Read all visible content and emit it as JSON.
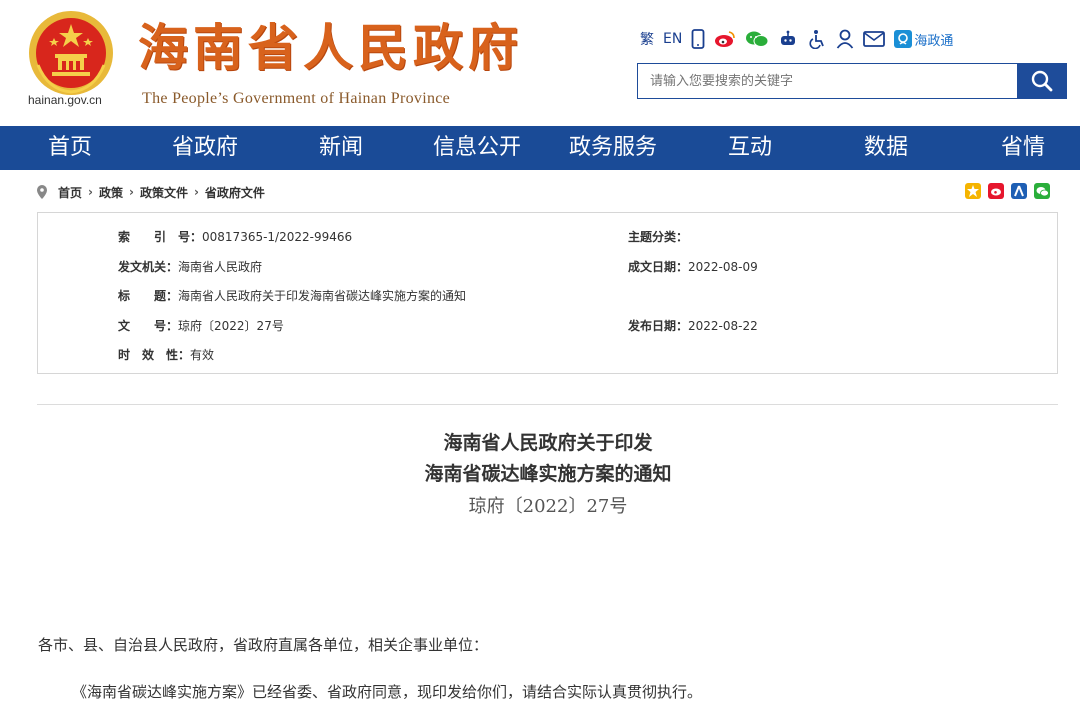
{
  "header": {
    "domain": "hainan.gov.cn",
    "site_title": "海南省人民政府",
    "site_subtitle": "The People’s Government  of Hainan Province",
    "toolbar": {
      "traditional": "繁",
      "english": "EN",
      "hzt_label": "海政通"
    },
    "search": {
      "placeholder": "请输入您要搜索的关键字"
    }
  },
  "nav": [
    "首页",
    "省政府",
    "新闻",
    "信息公开",
    "政务服务",
    "互动",
    "数据",
    "省情"
  ],
  "breadcrumb": [
    "首页",
    "政策",
    "政策文件",
    "省政府文件"
  ],
  "meta": {
    "index_label": "索　　引　号：",
    "index_value": "00817365-1/2022-99466",
    "topic_label": "主题分类：",
    "topic_value": "",
    "issuer_label": "发文机关：",
    "issuer_value": "海南省人民政府",
    "date_label": "成文日期：",
    "date_value": "2022-08-09",
    "title_label": "标　　题：",
    "title_value": "海南省人民政府关于印发海南省碳达峰实施方案的通知",
    "docno_label": "文　　号：",
    "docno_value": "琼府〔2022〕27号",
    "pubdate_label": "发布日期：",
    "pubdate_value": "2022-08-22",
    "validity_label": "时　效　性：",
    "validity_value": "有效"
  },
  "document": {
    "title_line1": "海南省人民政府关于印发",
    "title_line2": "海南省碳达峰实施方案的通知",
    "doc_number": "琼府〔2022〕27号",
    "salutation": "各市、县、自治县人民政府，省政府直属各单位，相关企事业单位：",
    "body_line1": "《海南省碳达峰实施方案》已经省委、省政府同意，现印发给你们，请结合实际认真贯彻执行。"
  },
  "colors": {
    "nav_bg": "#1a4b97",
    "title_orange": "#d8621c",
    "accent_blue": "#1e4c9a"
  }
}
